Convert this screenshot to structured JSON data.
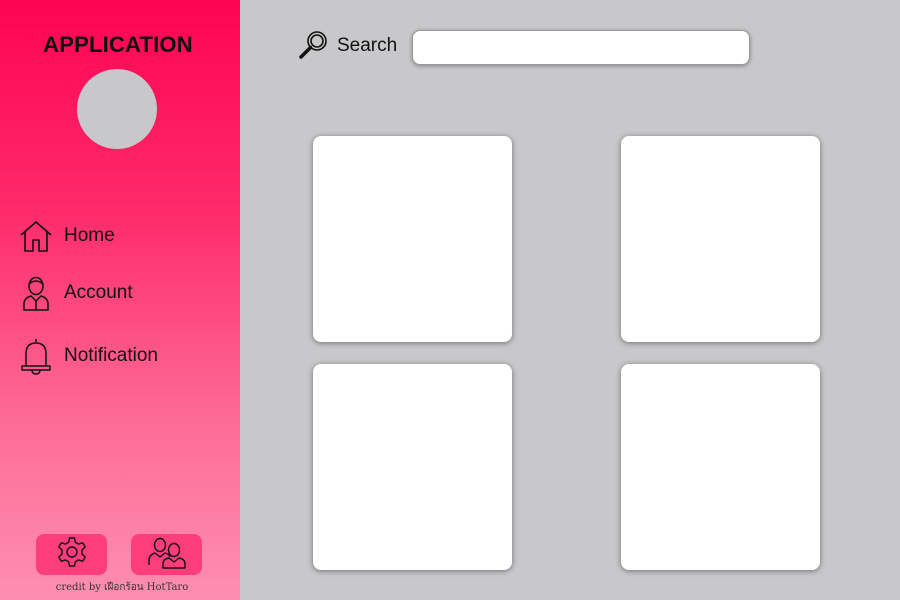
{
  "app": {
    "title": "APPLICATION"
  },
  "sidebar": {
    "items": [
      {
        "label": "Home",
        "icon": "home-icon"
      },
      {
        "label": "Account",
        "icon": "user-icon"
      },
      {
        "label": "Notification",
        "icon": "bell-icon"
      }
    ],
    "bottom_buttons": [
      {
        "icon": "gear-icon"
      },
      {
        "icon": "users-icon"
      }
    ],
    "credit": "credit by เฝือกร้อน HotTaro"
  },
  "search": {
    "label": "Search",
    "placeholder": "",
    "value": "",
    "icon": "search-icon"
  },
  "main": {
    "cards": [
      "",
      "",
      "",
      ""
    ]
  },
  "colors": {
    "accent": "#fe0452",
    "accent_light": "#fd8fb0",
    "button": "#fe3d7c",
    "background": "#c8c7c9",
    "card": "#ffffff"
  }
}
